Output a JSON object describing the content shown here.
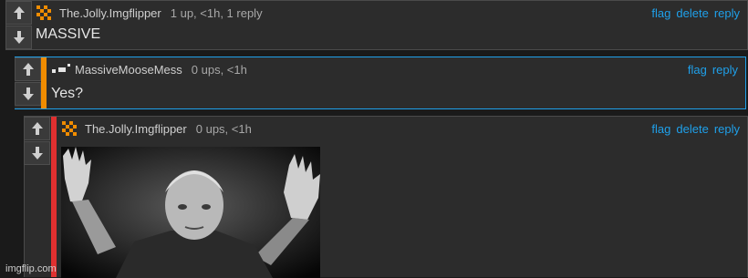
{
  "comments": [
    {
      "user": "The.Jolly.Imgflipper",
      "meta": "1 up, <1h, 1 reply",
      "text": "MASSIVE",
      "actions": [
        "flag",
        "delete",
        "reply"
      ],
      "accent": "#2c2c2c"
    },
    {
      "user": "MassiveMooseMess",
      "meta": "0 ups, <1h",
      "text": "Yes?",
      "actions": [
        "flag",
        "reply"
      ],
      "accent": "#f08c00"
    },
    {
      "user": "The.Jolly.Imgflipper",
      "meta": "0 ups, <1h",
      "text": "",
      "actions": [
        "flag",
        "delete",
        "reply"
      ],
      "accent": "#e03030",
      "image": "photo of an elderly man raising both hands"
    }
  ],
  "watermark": "imgflip.com",
  "colors": {
    "link": "#1fa0ea",
    "background": "#1a1a1a",
    "panel": "#2c2c2c"
  }
}
